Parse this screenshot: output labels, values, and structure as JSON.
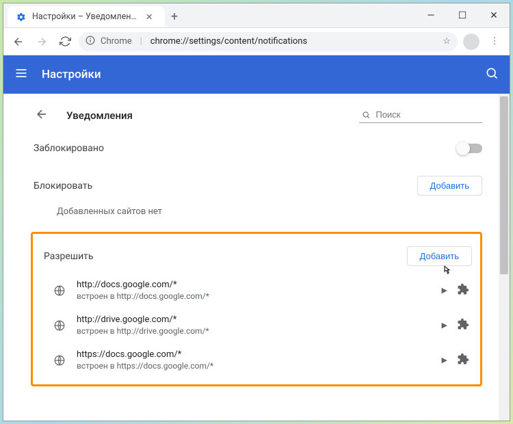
{
  "tab": {
    "title": "Настройки – Уведомления"
  },
  "omnibox": {
    "prefix": "Chrome",
    "path": "chrome://settings/content/notifications"
  },
  "header": {
    "title": "Настройки"
  },
  "page": {
    "back_title": "Уведомления",
    "search_placeholder": "Поиск"
  },
  "blocked_toggle": {
    "label": "Заблокировано"
  },
  "block_section": {
    "title": "Блокировать",
    "add_label": "Добавить",
    "empty": "Добавленных сайтов нет"
  },
  "allow_section": {
    "title": "Разрешить",
    "add_label": "Добавить",
    "sites": [
      {
        "url": "http://docs.google.com/*",
        "sub": "встроен в http://docs.google.com/*"
      },
      {
        "url": "http://drive.google.com/*",
        "sub": "встроен в http://drive.google.com/*"
      },
      {
        "url": "https://docs.google.com/*",
        "sub": "встроен в https://docs.google.com/*"
      }
    ]
  }
}
